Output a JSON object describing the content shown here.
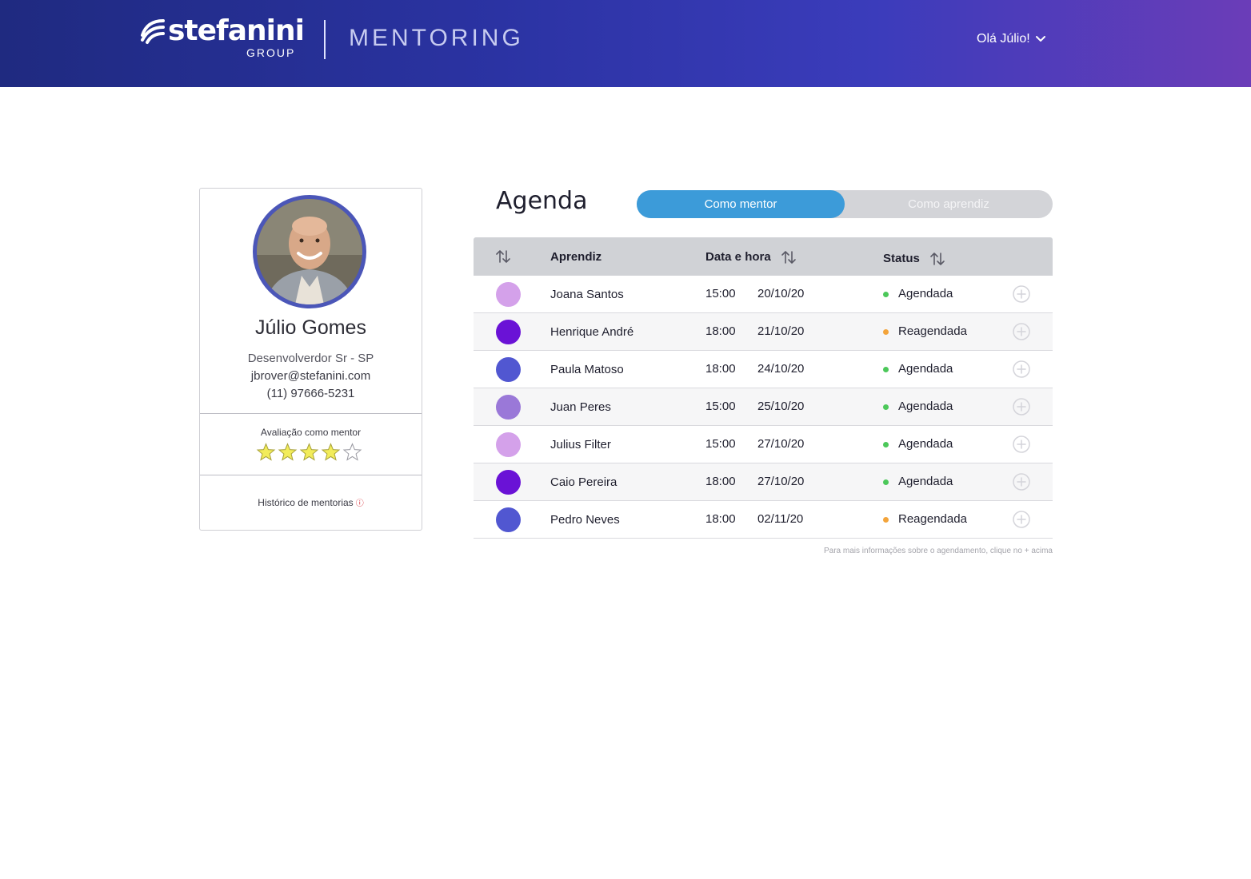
{
  "header": {
    "logo": {
      "word": "stefanini",
      "sub": "GROUP"
    },
    "app_name": "MENTORING",
    "greeting": "Olá Júlio!",
    "gradient_colors": [
      "#1f2a80",
      "#3b3cbb",
      "#6b3db8"
    ]
  },
  "profile": {
    "name": "Júlio Gomes",
    "role": "Desenvolverdor Sr - SP",
    "email": "jbrover@stefanini.com",
    "phone": "(11) 97666-5231",
    "rating_label": "Avaliação como mentor",
    "rating": 4,
    "rating_max": 5,
    "history_label": "Histórico de mentorias",
    "avatar_ring_color": "#4b56b8"
  },
  "agenda": {
    "title": "Agenda",
    "tabs": [
      {
        "label": "Como mentor",
        "active": true
      },
      {
        "label": "Como aprendiz",
        "active": false
      }
    ],
    "columns": {
      "learner": "Aprendiz",
      "datetime": "Data e hora",
      "status": "Status"
    },
    "rows": [
      {
        "color": "#d4a1ea",
        "name": "Joana Santos",
        "time": "15:00",
        "date": "20/10/20",
        "status": "Agendada",
        "status_color": "#4cc85a"
      },
      {
        "color": "#6a12d6",
        "name": "Henrique André",
        "time": "18:00",
        "date": "21/10/20",
        "status": "Reagendada",
        "status_color": "#f3a43b"
      },
      {
        "color": "#5157d1",
        "name": "Paula Matoso",
        "time": "18:00",
        "date": "24/10/20",
        "status": "Agendada",
        "status_color": "#4cc85a"
      },
      {
        "color": "#9a78d8",
        "name": "Juan Peres",
        "time": "15:00",
        "date": "25/10/20",
        "status": "Agendada",
        "status_color": "#4cc85a"
      },
      {
        "color": "#d4a1ea",
        "name": "Julius Filter",
        "time": "15:00",
        "date": "27/10/20",
        "status": "Agendada",
        "status_color": "#4cc85a"
      },
      {
        "color": "#6a12d6",
        "name": "Caio Pereira",
        "time": "18:00",
        "date": "27/10/20",
        "status": "Agendada",
        "status_color": "#4cc85a"
      },
      {
        "color": "#5157d1",
        "name": "Pedro Neves",
        "time": "18:00",
        "date": "02/11/20",
        "status": "Reagendada",
        "status_color": "#f3a43b"
      }
    ],
    "footnote": "Para mais informações sobre o agendamento, clique no + acima",
    "accent_color": "#3c9bd9"
  }
}
